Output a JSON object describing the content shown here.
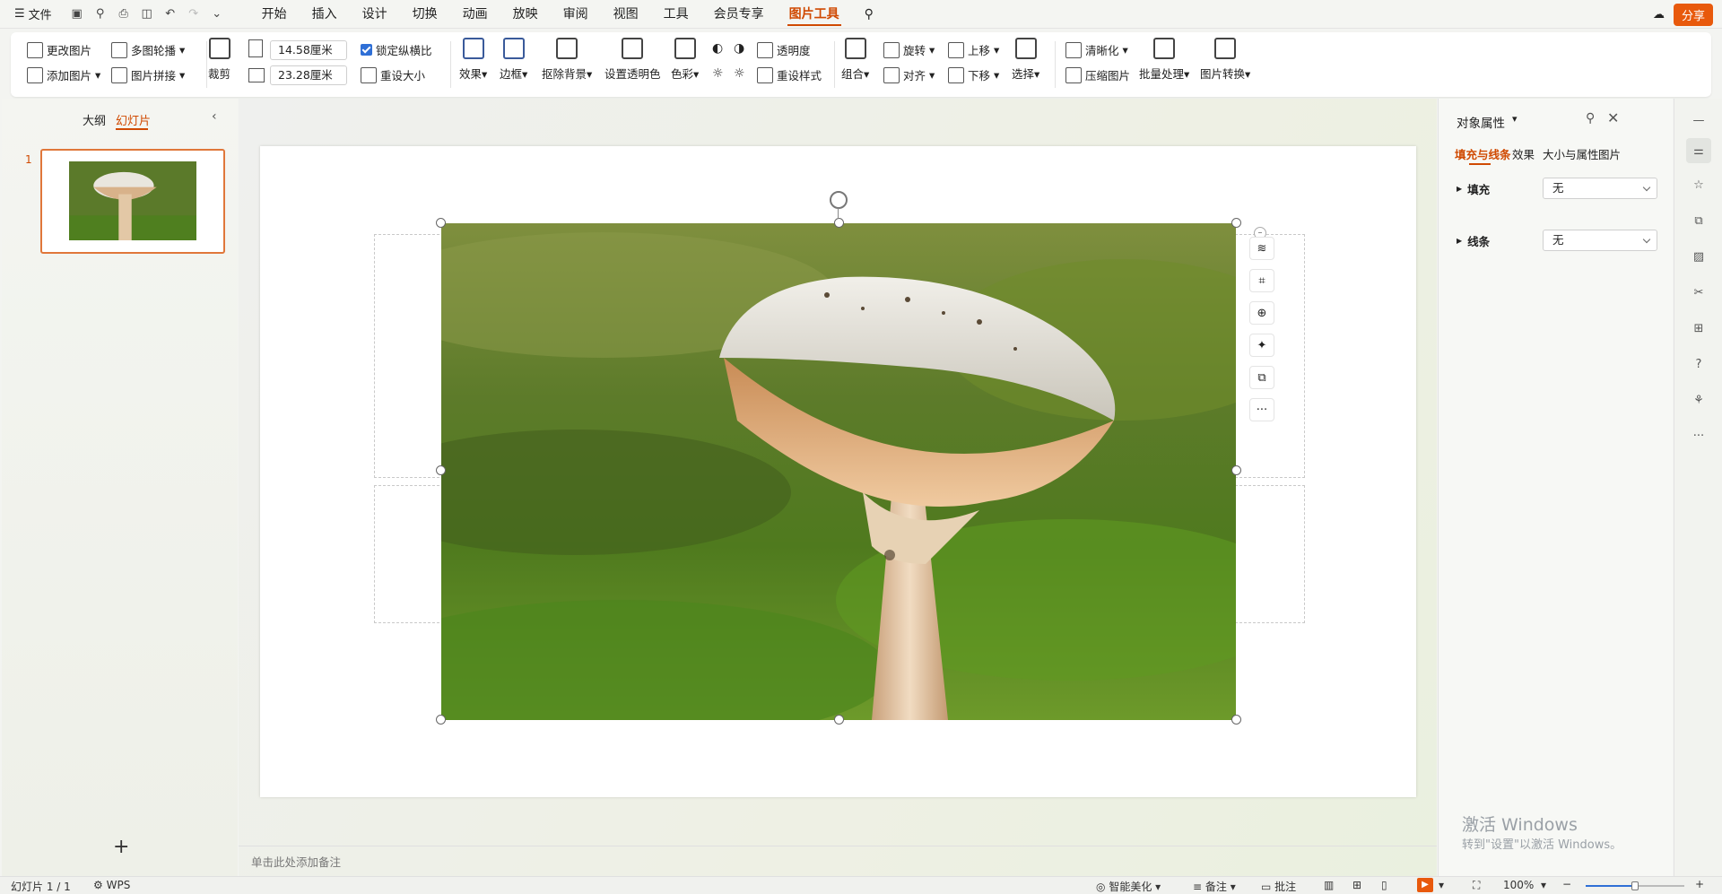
{
  "menu": {
    "file_label": "文件",
    "tabs": [
      "开始",
      "插入",
      "设计",
      "切换",
      "动画",
      "放映",
      "审阅",
      "视图",
      "工具",
      "会员专享",
      "图片工具"
    ],
    "active_tab": "图片工具",
    "share_label": "分享"
  },
  "ribbon": {
    "change_picture": "更改图片",
    "multi_carousel": "多图轮播",
    "add_picture": "添加图片",
    "picture_splice": "图片拼接",
    "crop": "裁剪",
    "height_value": "14.58厘米",
    "width_value": "23.28厘米",
    "lock_ratio": "锁定纵横比",
    "lock_ratio_checked": true,
    "reset_size": "重设大小",
    "effects": "效果",
    "border": "边框",
    "remove_bg": "抠除背景",
    "set_transparent": "设置透明色",
    "color": "色彩",
    "transparency": "透明度",
    "reset_style": "重设样式",
    "group": "组合",
    "rotate": "旋转",
    "align": "对齐",
    "bring_forward": "上移",
    "send_backward": "下移",
    "select": "选择",
    "sharpen": "清晰化",
    "compress": "压缩图片",
    "batch": "批量处理",
    "convert": "图片转换"
  },
  "left_panel": {
    "tab_outline": "大纲",
    "tab_slides": "幻灯片",
    "slide_number": "1",
    "add_label": "+"
  },
  "notes": {
    "placeholder": "单击此处添加备注"
  },
  "properties": {
    "title": "对象属性",
    "tabs": [
      "填充与线条",
      "效果",
      "大小与属性",
      "图片"
    ],
    "active_tab": "填充与线条",
    "fill_label": "填充",
    "fill_value": "无",
    "line_label": "线条",
    "line_value": "无"
  },
  "watermark": {
    "line1": "激活 Windows",
    "line2": "转到\"设置\"以激活 Windows。"
  },
  "status": {
    "slide_info": "幻灯片 1 / 1",
    "app": "WPS",
    "smart_beautify": "智能美化",
    "notes": "备注",
    "comments": "批注",
    "zoom": "100%",
    "zoom_level_fraction": 0.5
  },
  "colors": {
    "accent": "#d04a02",
    "share_bg": "#e8590c"
  }
}
